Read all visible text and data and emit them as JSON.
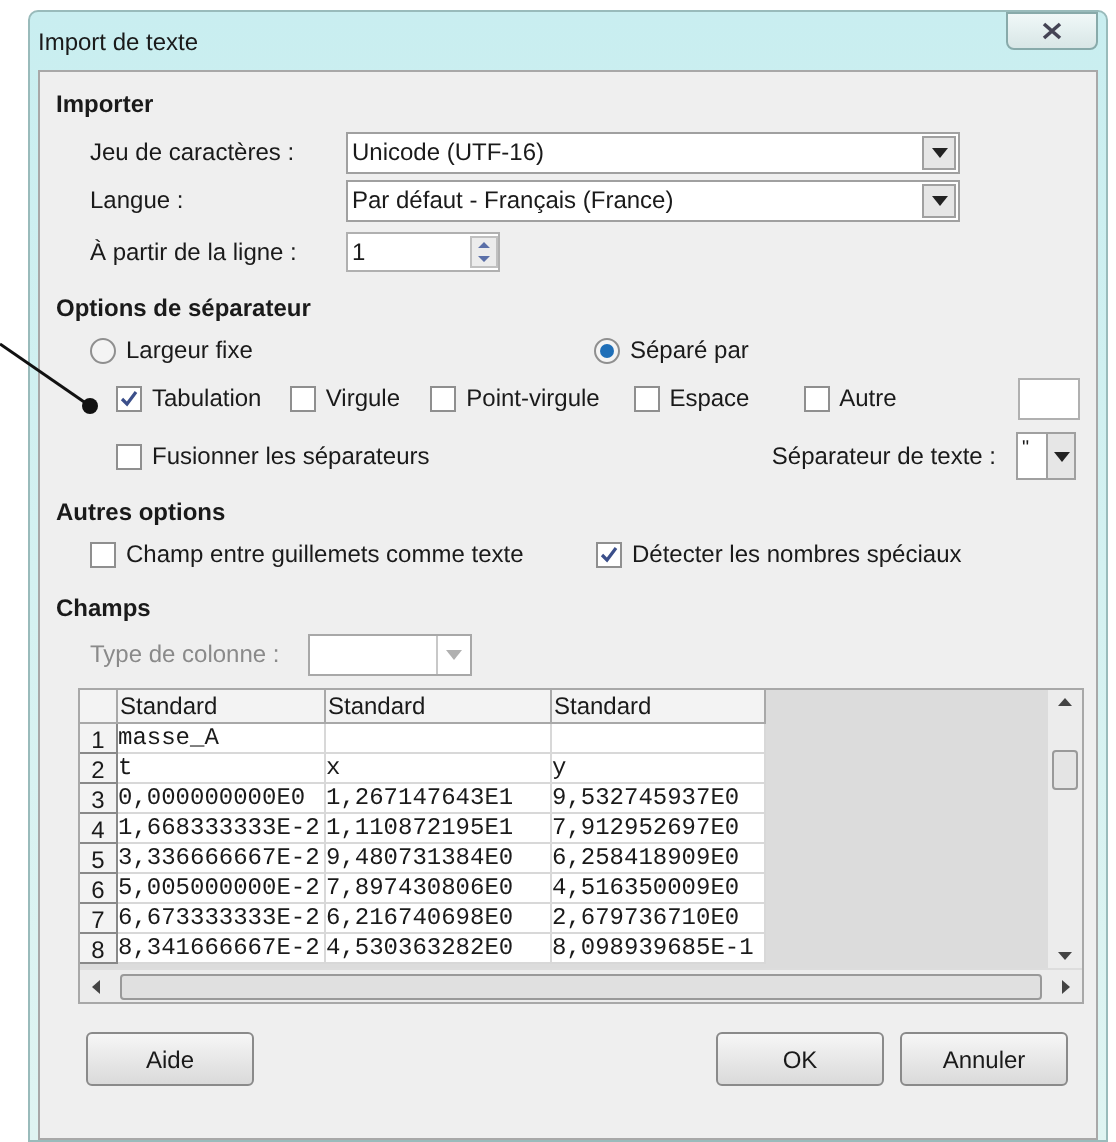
{
  "window": {
    "title": "Import de texte"
  },
  "importer": {
    "heading": "Importer",
    "fields": [
      {
        "kind": "dropdown",
        "label": "Jeu de caractères :",
        "value": "Unicode (UTF-16)"
      },
      {
        "kind": "dropdown",
        "label": "Langue :",
        "value": "Par défaut - Français (France)"
      },
      {
        "kind": "spin",
        "label": "À partir de la ligne :",
        "value": "1"
      }
    ]
  },
  "separator_options": {
    "heading": "Options de séparateur",
    "radios": [
      {
        "label": "Largeur fixe",
        "selected": false
      },
      {
        "label": "Séparé par",
        "selected": true
      }
    ],
    "separators": [
      {
        "label": "Tabulation",
        "checked": true
      },
      {
        "label": "Virgule",
        "checked": false
      },
      {
        "label": "Point-virgule",
        "checked": false
      },
      {
        "label": "Espace",
        "checked": false
      },
      {
        "label": "Autre",
        "checked": false
      }
    ],
    "merge": {
      "label": "Fusionner les séparateurs",
      "checked": false
    },
    "text_separator": {
      "label": "Séparateur de texte :",
      "value": "\""
    }
  },
  "other_options": {
    "heading": "Autres options",
    "checkboxes": [
      {
        "label": "Champ entre guillemets comme texte",
        "checked": false
      },
      {
        "label": "Détecter les nombres spéciaux",
        "checked": true
      }
    ]
  },
  "fields": {
    "heading": "Champs",
    "column_type": {
      "label": "Type de colonne :",
      "disabled": true
    },
    "table": {
      "columns": [
        "Standard",
        "Standard",
        "Standard"
      ],
      "rows": [
        {
          "number": "1",
          "cells": [
            "masse_A",
            "",
            ""
          ]
        },
        {
          "number": "2",
          "cells": [
            "t",
            "x",
            "y"
          ]
        },
        {
          "number": "3",
          "cells": [
            "0,000000000E0",
            "1,267147643E1",
            "9,532745937E0"
          ]
        },
        {
          "number": "4",
          "cells": [
            "1,668333333E-2",
            "1,110872195E1",
            "7,912952697E0"
          ]
        },
        {
          "number": "5",
          "cells": [
            "3,336666667E-2",
            "9,480731384E0",
            "6,258418909E0"
          ]
        },
        {
          "number": "6",
          "cells": [
            "5,005000000E-2",
            "7,897430806E0",
            "4,516350009E0"
          ]
        },
        {
          "number": "7",
          "cells": [
            "6,673333333E-2",
            "6,216740698E0",
            "2,679736710E0"
          ]
        },
        {
          "number": "8",
          "cells": [
            "8,341666667E-2",
            "4,530363282E0",
            "8,098939685E-1"
          ]
        }
      ]
    }
  },
  "buttons": [
    "Aide",
    "OK",
    "Annuler"
  ]
}
